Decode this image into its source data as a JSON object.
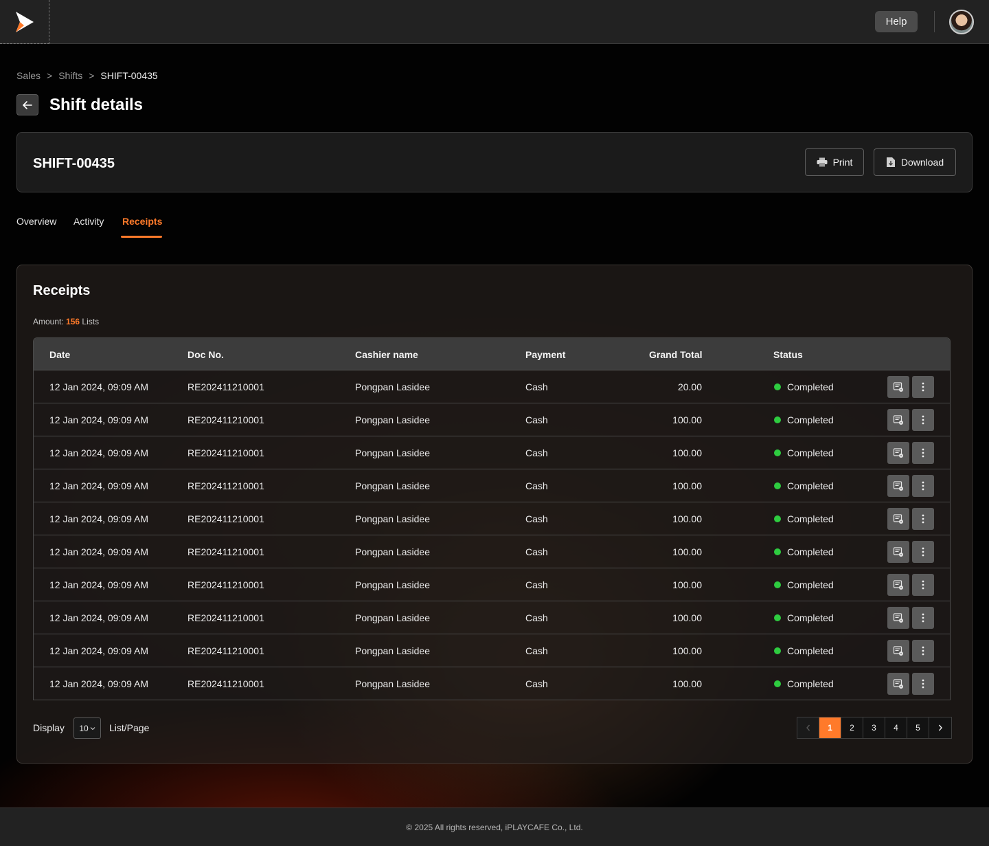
{
  "topbar": {
    "help_label": "Help",
    "logo_icon": "play-logo-icon",
    "avatar_icon": "user-avatar"
  },
  "breadcrumb": {
    "items": [
      "Sales",
      "Shifts",
      "SHIFT-00435"
    ],
    "separator": ">"
  },
  "page": {
    "title": "Shift details"
  },
  "shift": {
    "id": "SHIFT-00435",
    "print_label": "Print",
    "download_label": "Download"
  },
  "tabs": [
    {
      "label": "Overview",
      "active": false
    },
    {
      "label": "Activity",
      "active": false
    },
    {
      "label": "Receipts",
      "active": true
    }
  ],
  "receipts": {
    "title": "Receipts",
    "amount_label": "Amount:",
    "amount_value": "156",
    "amount_suffix": "Lists",
    "columns": {
      "date": "Date",
      "doc_no": "Doc No.",
      "cashier": "Cashier name",
      "payment": "Payment",
      "grand_total": "Grand Total",
      "status": "Status"
    },
    "rows": [
      {
        "date": "12 Jan 2024, 09:09 AM",
        "doc_no": "RE202411210001",
        "cashier": "Pongpan Lasidee",
        "payment": "Cash",
        "grand_total": "20.00",
        "status": "Completed"
      },
      {
        "date": "12 Jan 2024, 09:09 AM",
        "doc_no": "RE202411210001",
        "cashier": "Pongpan Lasidee",
        "payment": "Cash",
        "grand_total": "100.00",
        "status": "Completed"
      },
      {
        "date": "12 Jan 2024, 09:09 AM",
        "doc_no": "RE202411210001",
        "cashier": "Pongpan Lasidee",
        "payment": "Cash",
        "grand_total": "100.00",
        "status": "Completed"
      },
      {
        "date": "12 Jan 2024, 09:09 AM",
        "doc_no": "RE202411210001",
        "cashier": "Pongpan Lasidee",
        "payment": "Cash",
        "grand_total": "100.00",
        "status": "Completed"
      },
      {
        "date": "12 Jan 2024, 09:09 AM",
        "doc_no": "RE202411210001",
        "cashier": "Pongpan Lasidee",
        "payment": "Cash",
        "grand_total": "100.00",
        "status": "Completed"
      },
      {
        "date": "12 Jan 2024, 09:09 AM",
        "doc_no": "RE202411210001",
        "cashier": "Pongpan Lasidee",
        "payment": "Cash",
        "grand_total": "100.00",
        "status": "Completed"
      },
      {
        "date": "12 Jan 2024, 09:09 AM",
        "doc_no": "RE202411210001",
        "cashier": "Pongpan Lasidee",
        "payment": "Cash",
        "grand_total": "100.00",
        "status": "Completed"
      },
      {
        "date": "12 Jan 2024, 09:09 AM",
        "doc_no": "RE202411210001",
        "cashier": "Pongpan Lasidee",
        "payment": "Cash",
        "grand_total": "100.00",
        "status": "Completed"
      },
      {
        "date": "12 Jan 2024, 09:09 AM",
        "doc_no": "RE202411210001",
        "cashier": "Pongpan Lasidee",
        "payment": "Cash",
        "grand_total": "100.00",
        "status": "Completed"
      },
      {
        "date": "12 Jan 2024, 09:09 AM",
        "doc_no": "RE202411210001",
        "cashier": "Pongpan Lasidee",
        "payment": "Cash",
        "grand_total": "100.00",
        "status": "Completed"
      }
    ]
  },
  "pagination": {
    "display_label": "Display",
    "page_size": "10",
    "list_page_label": "List/Page",
    "pages": [
      "1",
      "2",
      "3",
      "4",
      "5"
    ],
    "current_page": "1"
  },
  "footer": {
    "copyright": "© 2025 All rights reserved, iPLAYCAFE Co., Ltd."
  },
  "colors": {
    "accent": "#ff7a2a",
    "status_completed": "#2ecc40"
  }
}
